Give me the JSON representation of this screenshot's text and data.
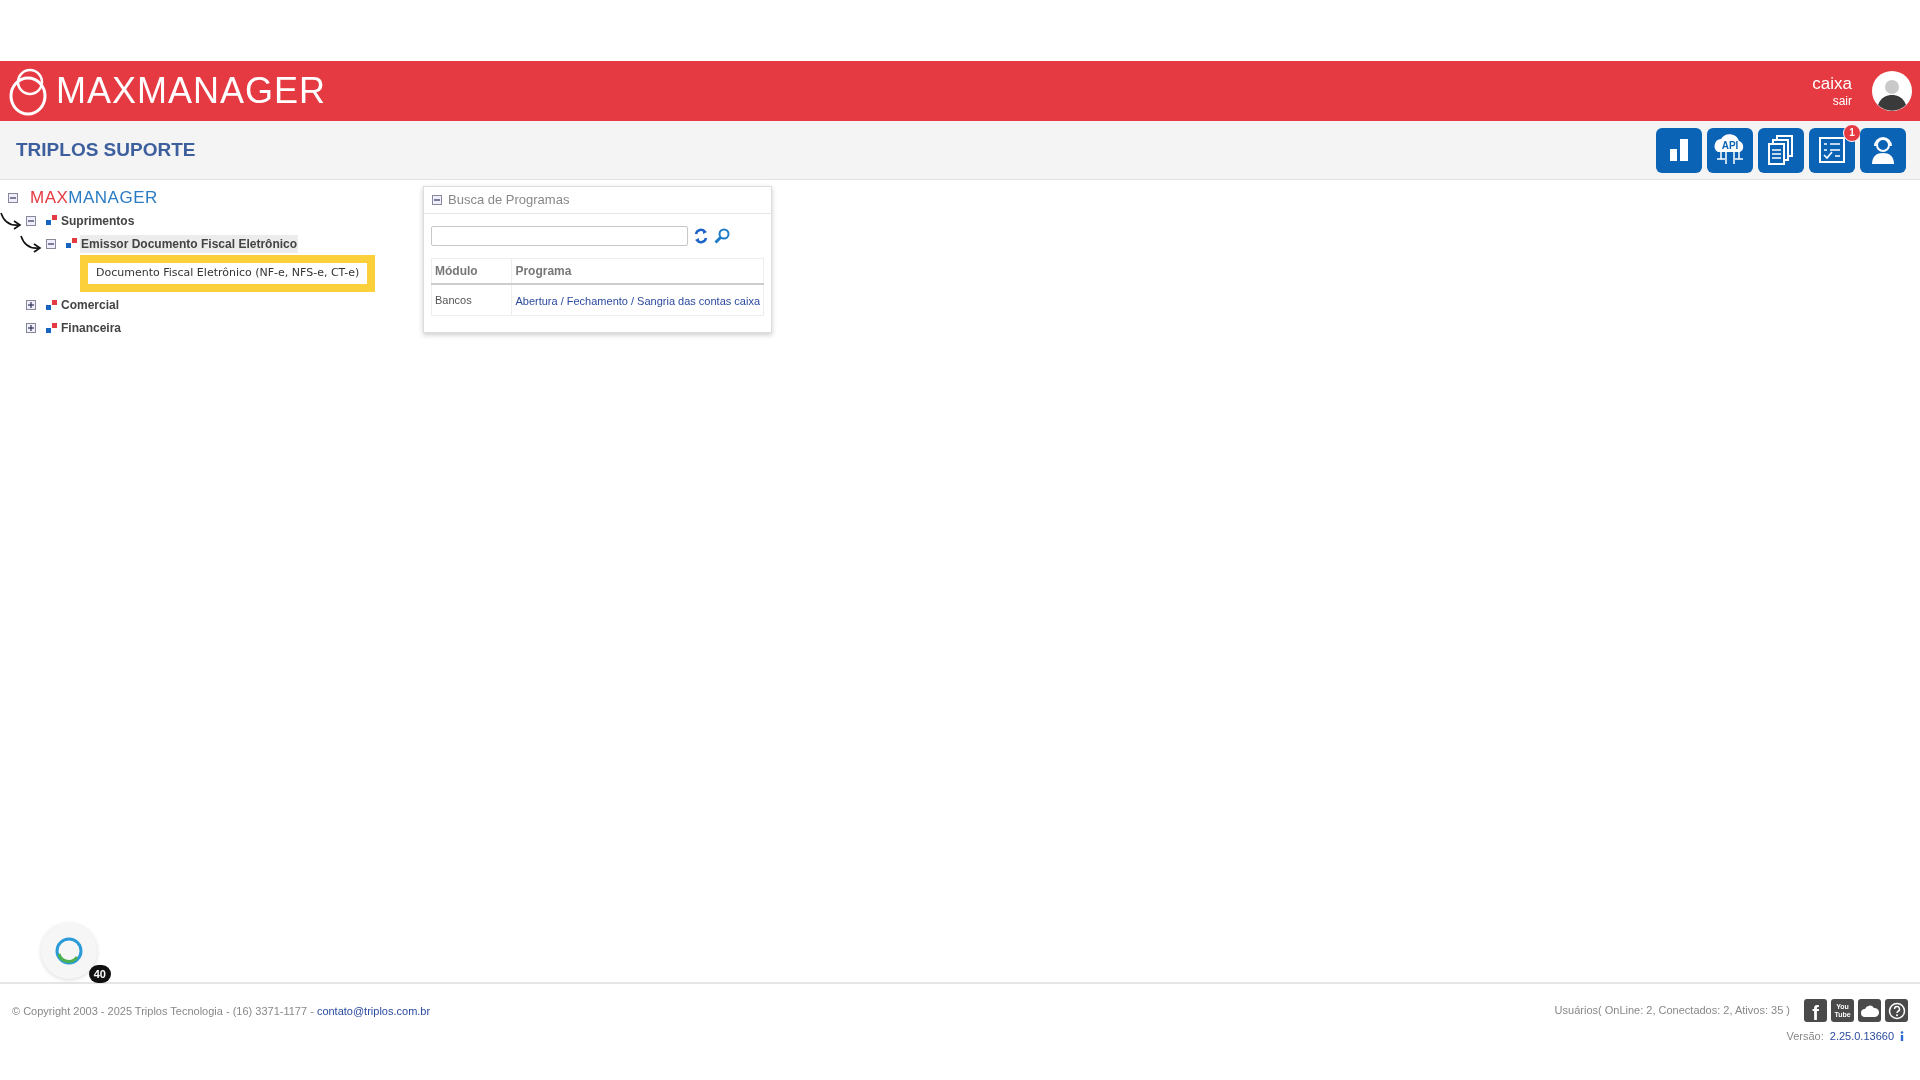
{
  "header": {
    "logo": "MAXMANAGER",
    "user": "caixa",
    "logout": "sair"
  },
  "subheader": {
    "title": "TRIPLOS SUPORTE",
    "buttons": [
      {
        "kind": "chart"
      },
      {
        "kind": "api",
        "label": "API"
      },
      {
        "kind": "documents"
      },
      {
        "kind": "checklist",
        "badge": "1"
      },
      {
        "kind": "support"
      }
    ]
  },
  "tree": {
    "root": {
      "max": "MAX",
      "manager": "MANAGER",
      "expanded": true
    },
    "items": [
      {
        "label": "Suprimentos",
        "expanded": true,
        "arrow": true,
        "selected": false,
        "children": [
          {
            "label": "Emissor Documento Fiscal Eletrônico",
            "expanded": true,
            "arrow": true,
            "selected": true,
            "tooltip": "Documento Fiscal Eletrônico (NF-e, NFS-e, CT-e)"
          }
        ]
      },
      {
        "label": "Comercial",
        "expanded": false,
        "arrow": false,
        "selected": false
      },
      {
        "label": "Financeira",
        "expanded": false,
        "arrow": false,
        "selected": false
      }
    ]
  },
  "search_panel": {
    "title": "Busca de Programas",
    "expanded": true,
    "columns": [
      "Módulo",
      "Programa"
    ],
    "rows": [
      {
        "module": "Bancos",
        "program": "Abertura / Fechamento / Sangria das contas caixa"
      }
    ]
  },
  "chat_badge": "40",
  "footer": {
    "copyright": "© Copyright 2003 - 2025 Triplos Tecnologia - (16) 3371-1177 - ",
    "email": "contato@triplos.com.br",
    "users": "Usuários( OnLine: 2, Conectados: 2, Ativos: 35 )",
    "social": [
      {
        "kind": "facebook",
        "label": "f"
      },
      {
        "kind": "youtube",
        "label": "You Tube"
      },
      {
        "kind": "cloud"
      },
      {
        "kind": "help"
      }
    ],
    "version_label": "Versão:",
    "version": "2.25.0.13660"
  }
}
